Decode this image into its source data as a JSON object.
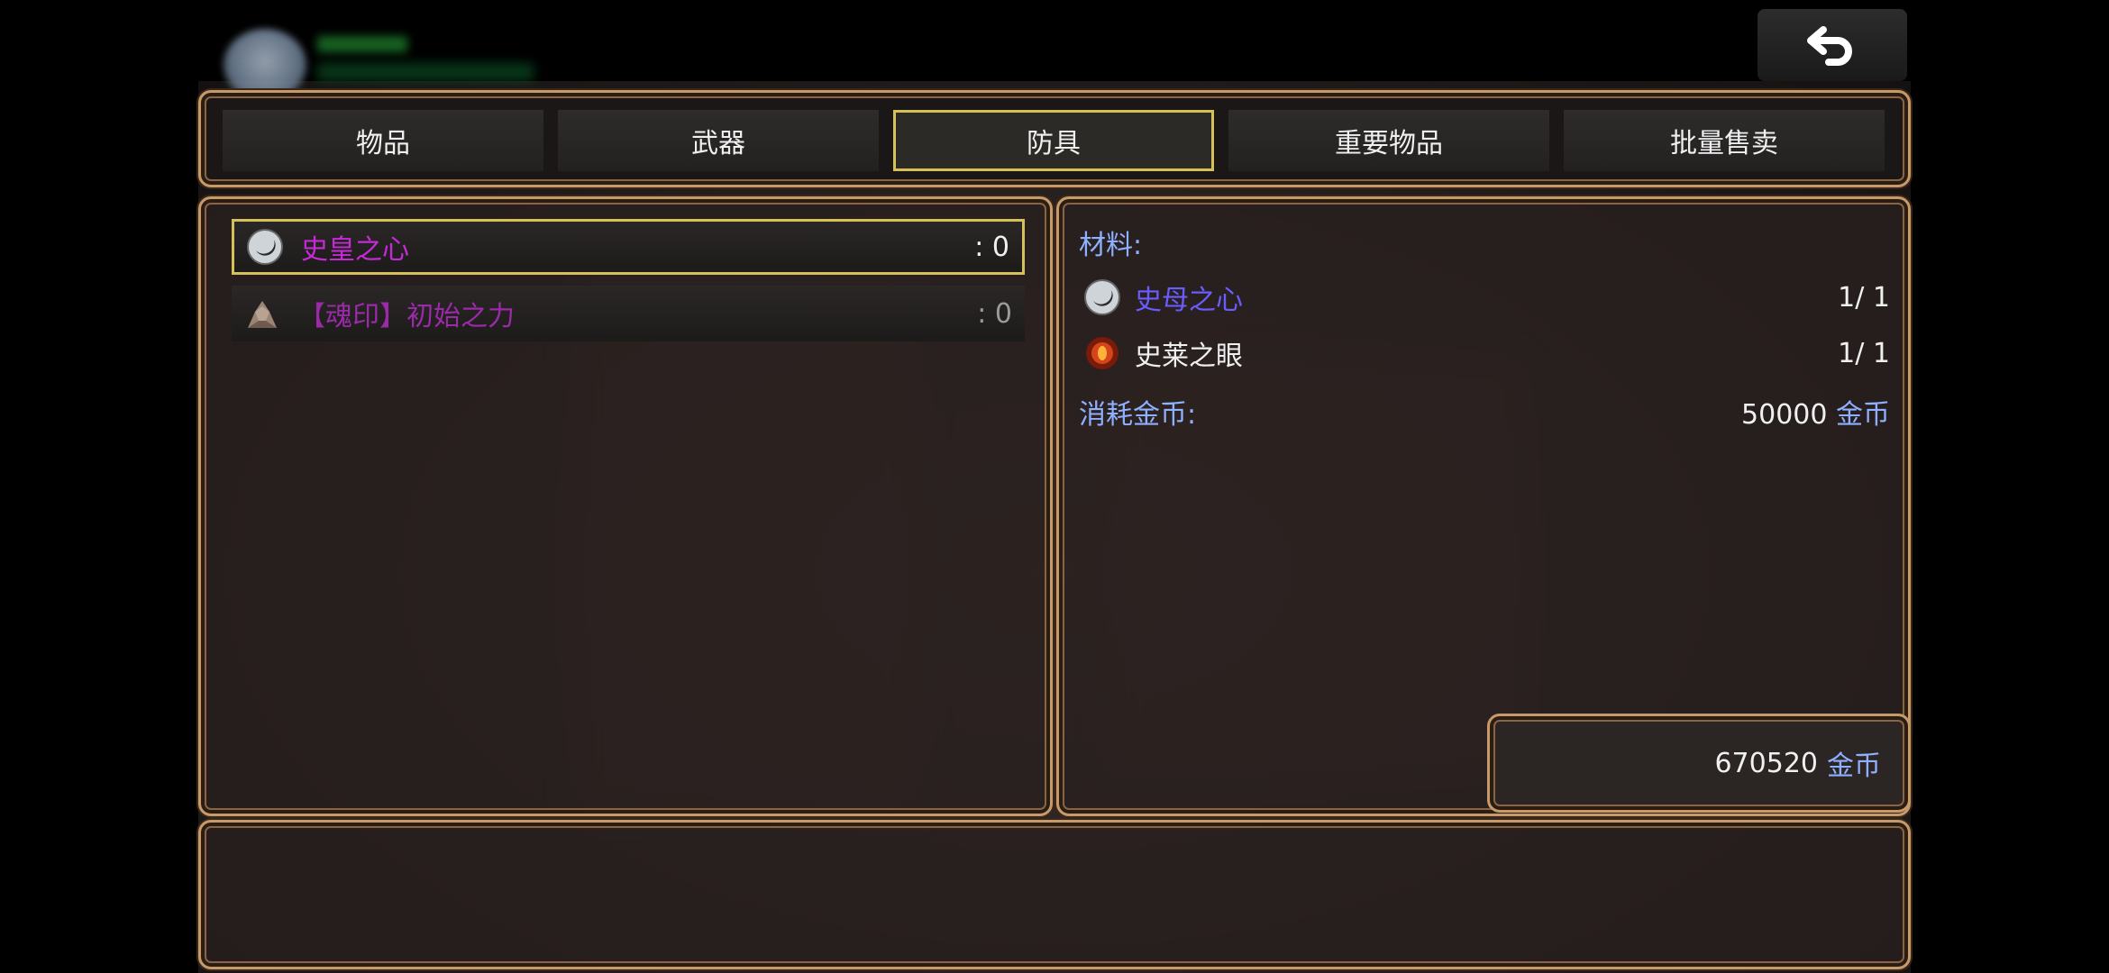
{
  "tabs": [
    {
      "label": "物品",
      "active": false
    },
    {
      "label": "武器",
      "active": false
    },
    {
      "label": "防具",
      "active": true
    },
    {
      "label": "重要物品",
      "active": false
    },
    {
      "label": "批量售卖",
      "active": false
    }
  ],
  "item_list": [
    {
      "name": "史皇之心",
      "count": ": 0",
      "icon": "silver-orb-icon",
      "selected": true
    },
    {
      "name": "【魂印】初始之力",
      "count": ": 0",
      "icon": "stone-pile-icon",
      "selected": false
    }
  ],
  "details": {
    "materials_label": "材料:",
    "materials": [
      {
        "name": "史母之心",
        "count": "1/ 1",
        "icon": "silver-orb-icon",
        "color": "#6a5cff"
      },
      {
        "name": "史莱之眼",
        "count": "1/ 1",
        "icon": "red-eye-icon",
        "color": "#f0f0f0"
      }
    ],
    "cost_label": "消耗金币:",
    "cost_value": "50000",
    "cost_unit": "金币"
  },
  "gold": {
    "value": "670520",
    "unit": "金币"
  },
  "colors": {
    "accent_gold": "#d6c058",
    "frame": "#c79a6a",
    "purple_item": "#c52ad6",
    "blue_label": "#8fb0ff"
  }
}
